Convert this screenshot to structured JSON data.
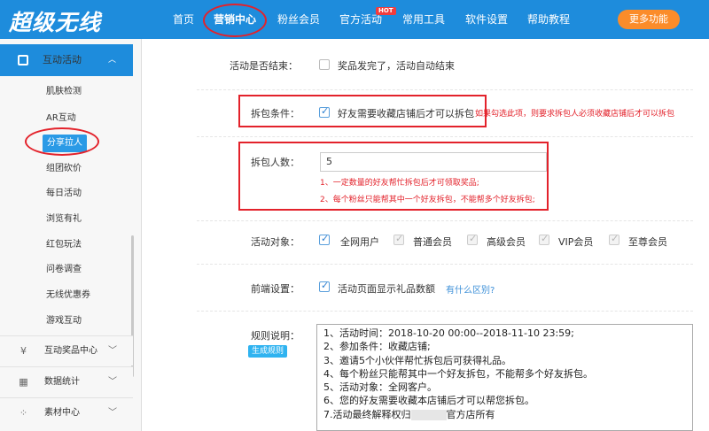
{
  "header": {
    "logo": "超级无线",
    "nav": [
      {
        "label": "首页"
      },
      {
        "label": "营销中心"
      },
      {
        "label": "粉丝会员"
      },
      {
        "label": "官方活动"
      },
      {
        "label": "常用工具"
      },
      {
        "label": "软件设置"
      },
      {
        "label": "帮助教程"
      }
    ],
    "hot_badge": "HOT",
    "more_button": "更多功能"
  },
  "sidebar": {
    "section": "互动活动",
    "items": [
      "肌肤检测",
      "AR互动",
      "分享拉人",
      "组团砍价",
      "每日活动",
      "浏览有礼",
      "红包玩法",
      "问卷调查",
      "无线优惠券",
      "游戏互动"
    ],
    "groups": [
      "互动奖品中心",
      "数据统计",
      "素材中心"
    ]
  },
  "form": {
    "end_label": "活动是否结束：",
    "end_text": "奖品发完了，活动自动结束",
    "unpack_label": "拆包条件：",
    "unpack_text": "好友需要收藏店铺后才可以拆包",
    "unpack_note": "如果勾选此项，则要求拆包人必须收藏店铺后才可以拆包",
    "count_label": "拆包人数：",
    "count_value": "5",
    "count_note1": "1、一定数量的好友帮忙拆包后才可领取奖品;",
    "count_note2": "2、每个粉丝只能帮其中一个好友拆包，不能帮多个好友拆包;",
    "target_label": "活动对象：",
    "targets": [
      "全网用户",
      "普通会员",
      "高级会员",
      "VIP会员",
      "至尊会员"
    ],
    "front_label": "前端设置：",
    "front_text": "活动页面显示礼品数额",
    "front_link": "有什么区别?",
    "rules_label": "规则说明：",
    "rules_badge": "生成规则",
    "rules": [
      "1、活动时间：2018-10-20 00:00--2018-11-10 23:59;",
      "2、参加条件：收藏店铺;",
      "3、邀请5个小伙伴帮忙拆包后可获得礼品。",
      "4、每个粉丝只能帮其中一个好友拆包，不能帮多个好友拆包。",
      "5、活动对象：全网客户。",
      "6、您的好友需要收藏本店铺后才可以帮您拆包。",
      "7.活动最终解释权归",
      "官方店所有"
    ]
  }
}
